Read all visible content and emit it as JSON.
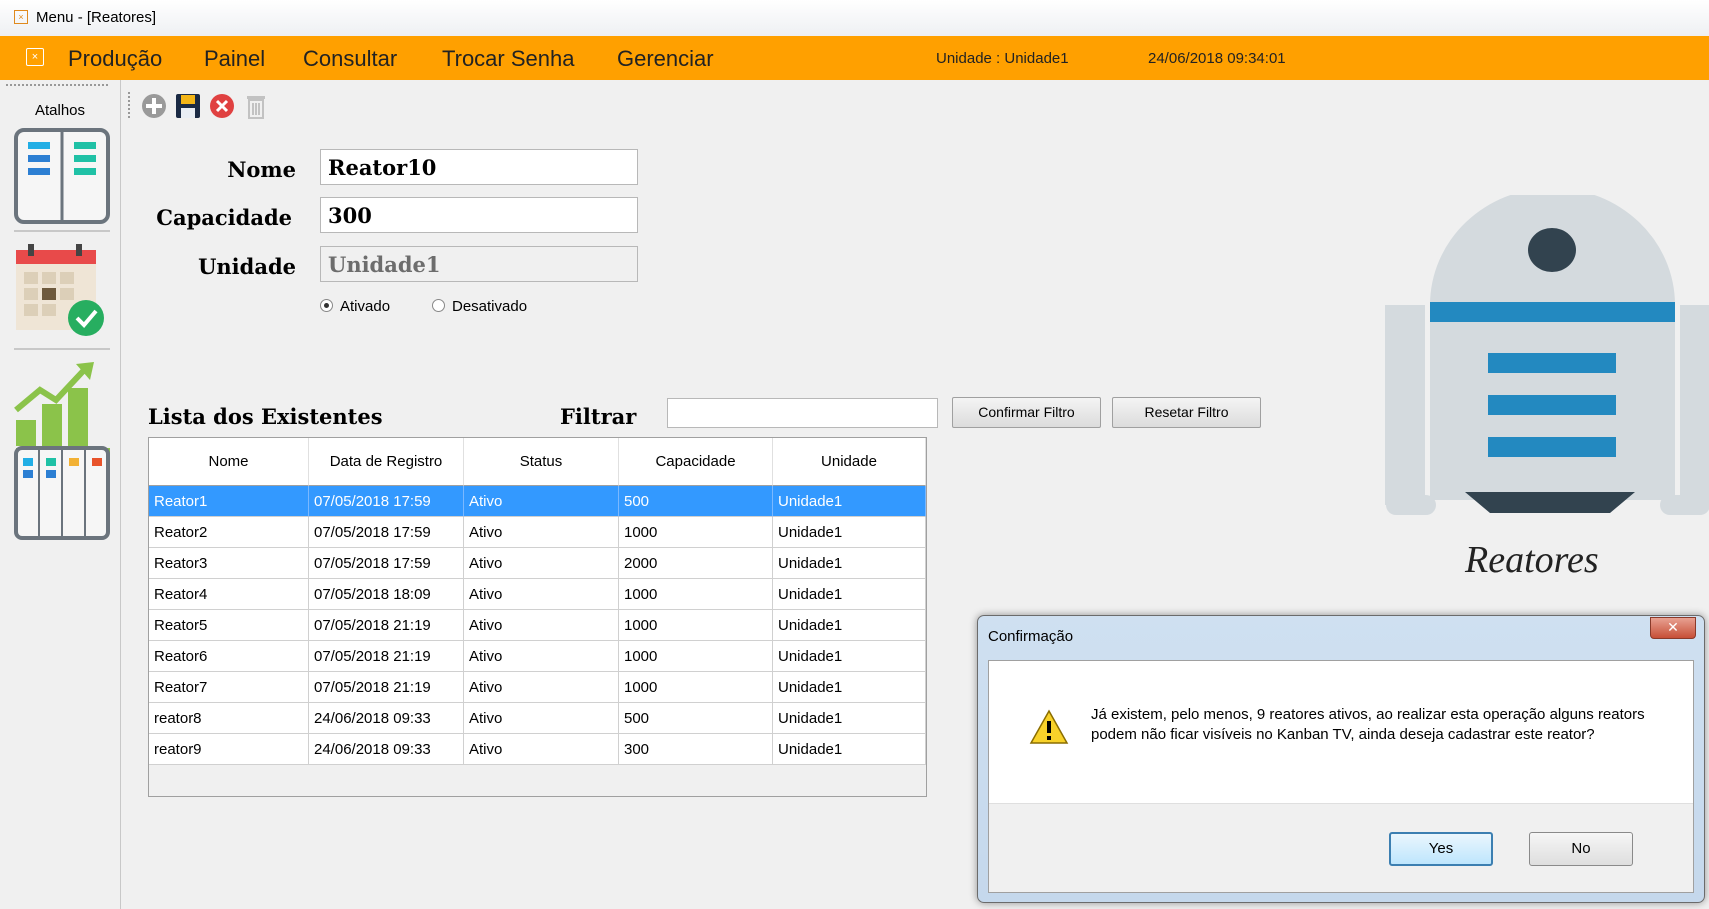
{
  "window": {
    "title": "Menu - [Reatores]"
  },
  "menu": {
    "items": [
      "Produção",
      "Painel",
      "Consultar",
      "Trocar Senha",
      "Gerenciar"
    ],
    "unidade": "Unidade : Unidade1",
    "datetime": "24/06/2018 09:34:01",
    "accent_color": "#ffa000"
  },
  "sidebar": {
    "label": "Atalhos",
    "shortcuts": [
      "kanban-board-icon",
      "calendar-check-icon",
      "growth-chart-icon",
      "task-board-icon"
    ]
  },
  "toolbar": {
    "icons": [
      "add-icon",
      "save-icon",
      "cancel-icon",
      "delete-icon"
    ]
  },
  "form": {
    "nome_label": "Nome",
    "nome_value": "Reator10",
    "capacidade_label": "Capacidade",
    "capacidade_value": "300",
    "unidade_label": "Unidade",
    "unidade_value": "Unidade1",
    "status_options": [
      "Ativado",
      "Desativado"
    ],
    "status_selected": "Ativado"
  },
  "list": {
    "title": "Lista dos Existentes",
    "filter_label": "Filtrar",
    "filter_value": "",
    "confirm_button": "Confirmar Filtro",
    "reset_button": "Resetar Filtro",
    "columns": [
      "Nome",
      "Data de Registro",
      "Status",
      "Capacidade",
      "Unidade"
    ],
    "rows": [
      [
        "Reator1",
        "07/05/2018 17:59",
        "Ativo",
        "500",
        "Unidade1"
      ],
      [
        "Reator2",
        "07/05/2018 17:59",
        "Ativo",
        "1000",
        "Unidade1"
      ],
      [
        "Reator3",
        "07/05/2018 17:59",
        "Ativo",
        "2000",
        "Unidade1"
      ],
      [
        "Reator4",
        "07/05/2018 18:09",
        "Ativo",
        "1000",
        "Unidade1"
      ],
      [
        "Reator5",
        "07/05/2018 21:19",
        "Ativo",
        "1000",
        "Unidade1"
      ],
      [
        "Reator6",
        "07/05/2018 21:19",
        "Ativo",
        "1000",
        "Unidade1"
      ],
      [
        "Reator7",
        "07/05/2018 21:19",
        "Ativo",
        "1000",
        "Unidade1"
      ],
      [
        "reator8",
        "24/06/2018 09:33",
        "Ativo",
        "500",
        "Unidade1"
      ],
      [
        "reator9",
        "24/06/2018 09:33",
        "Ativo",
        "300",
        "Unidade1"
      ]
    ],
    "selected_row": 0,
    "selection_color": "#3399ff"
  },
  "illustration": {
    "caption": "Reatores"
  },
  "dialog": {
    "title": "Confirmação",
    "message": "Já existem, pelo menos, 9 reatores ativos, ao realizar esta operação alguns reators podem não ficar visíveis no Kanban TV, ainda deseja cadastrar este reator?",
    "yes_label": "Yes",
    "no_label": "No"
  }
}
